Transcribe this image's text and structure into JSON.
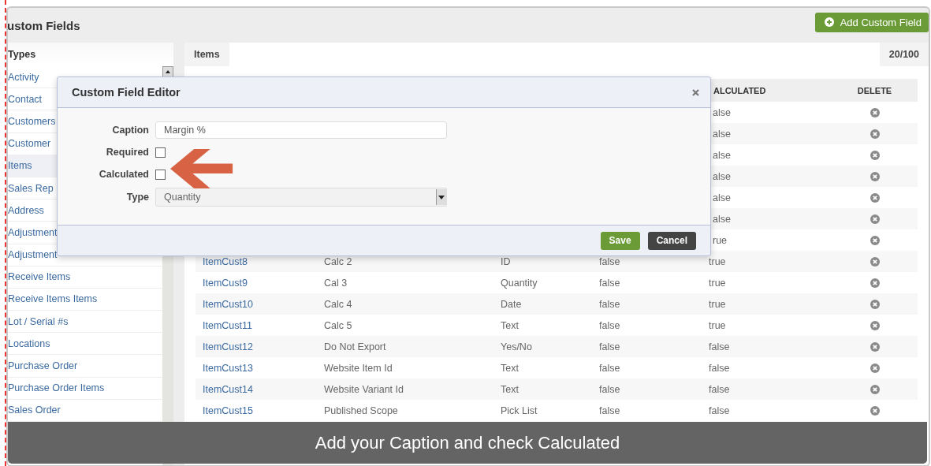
{
  "page": {
    "title": "ustom Fields",
    "add_button": "Add Custom Field"
  },
  "sidebar": {
    "heading": "Types",
    "items": [
      {
        "label": "Activity",
        "selected": false
      },
      {
        "label": "Contact",
        "selected": false
      },
      {
        "label": "Customers",
        "selected": false
      },
      {
        "label": "Customer",
        "selected": false
      },
      {
        "label": "Items",
        "selected": true
      },
      {
        "label": "Sales Rep",
        "selected": false
      },
      {
        "label": "Address",
        "selected": false
      },
      {
        "label": "Adjustment",
        "selected": false
      },
      {
        "label": "Adjustment",
        "selected": false
      },
      {
        "label": "Receive Items",
        "selected": false
      },
      {
        "label": "Receive Items Items",
        "selected": false
      },
      {
        "label": "Lot / Serial #s",
        "selected": false
      },
      {
        "label": "Locations",
        "selected": false
      },
      {
        "label": "Purchase Order",
        "selected": false
      },
      {
        "label": "Purchase Order Items",
        "selected": false
      },
      {
        "label": "Sales Order",
        "selected": false
      }
    ]
  },
  "tab": {
    "label": "Items",
    "count": "20/100"
  },
  "table": {
    "columns": [
      {
        "label": "ALCULATED"
      },
      {
        "label": "DELETE"
      }
    ],
    "rows": [
      {
        "calculated": "alse"
      },
      {
        "calculated": "alse"
      },
      {
        "calculated": "alse"
      },
      {
        "calculated": "alse"
      },
      {
        "calculated": "alse"
      },
      {
        "calculated": "alse"
      },
      {
        "calculated": "rue"
      },
      {
        "name": "ItemCust8",
        "caption": "Calc 2",
        "type": "ID",
        "required": "false",
        "calculated": "true"
      },
      {
        "name": "ItemCust9",
        "caption": "Cal 3",
        "type": "Quantity",
        "required": "false",
        "calculated": "true"
      },
      {
        "name": "ItemCust10",
        "caption": "Calc 4",
        "type": "Date",
        "required": "false",
        "calculated": "true"
      },
      {
        "name": "ItemCust11",
        "caption": "Calc 5",
        "type": "Text",
        "required": "false",
        "calculated": "true"
      },
      {
        "name": "ItemCust12",
        "caption": "Do Not Export",
        "type": "Yes/No",
        "required": "false",
        "calculated": "false"
      },
      {
        "name": "ItemCust13",
        "caption": "Website Item Id",
        "type": "Text",
        "required": "false",
        "calculated": "false"
      },
      {
        "name": "ItemCust14",
        "caption": "Website Variant Id",
        "type": "Text",
        "required": "false",
        "calculated": "false"
      },
      {
        "name": "ItemCust15",
        "caption": "Published Scope",
        "type": "Pick List",
        "required": "false",
        "calculated": "false"
      }
    ]
  },
  "modal": {
    "title": "Custom Field Editor",
    "fields": [
      {
        "kind": "text",
        "label": "Caption",
        "value": "Margin %"
      },
      {
        "kind": "checkbox",
        "label": "Required",
        "checked": false
      },
      {
        "kind": "checkbox",
        "label": "Calculated",
        "checked": false
      },
      {
        "kind": "select",
        "label": "Type",
        "value": "Quantity"
      }
    ],
    "buttons": [
      {
        "kind": "primary",
        "label": "Save"
      },
      {
        "kind": "secondary",
        "label": "Cancel"
      }
    ]
  },
  "caption_bar": "Add your Caption and check Calculated"
}
